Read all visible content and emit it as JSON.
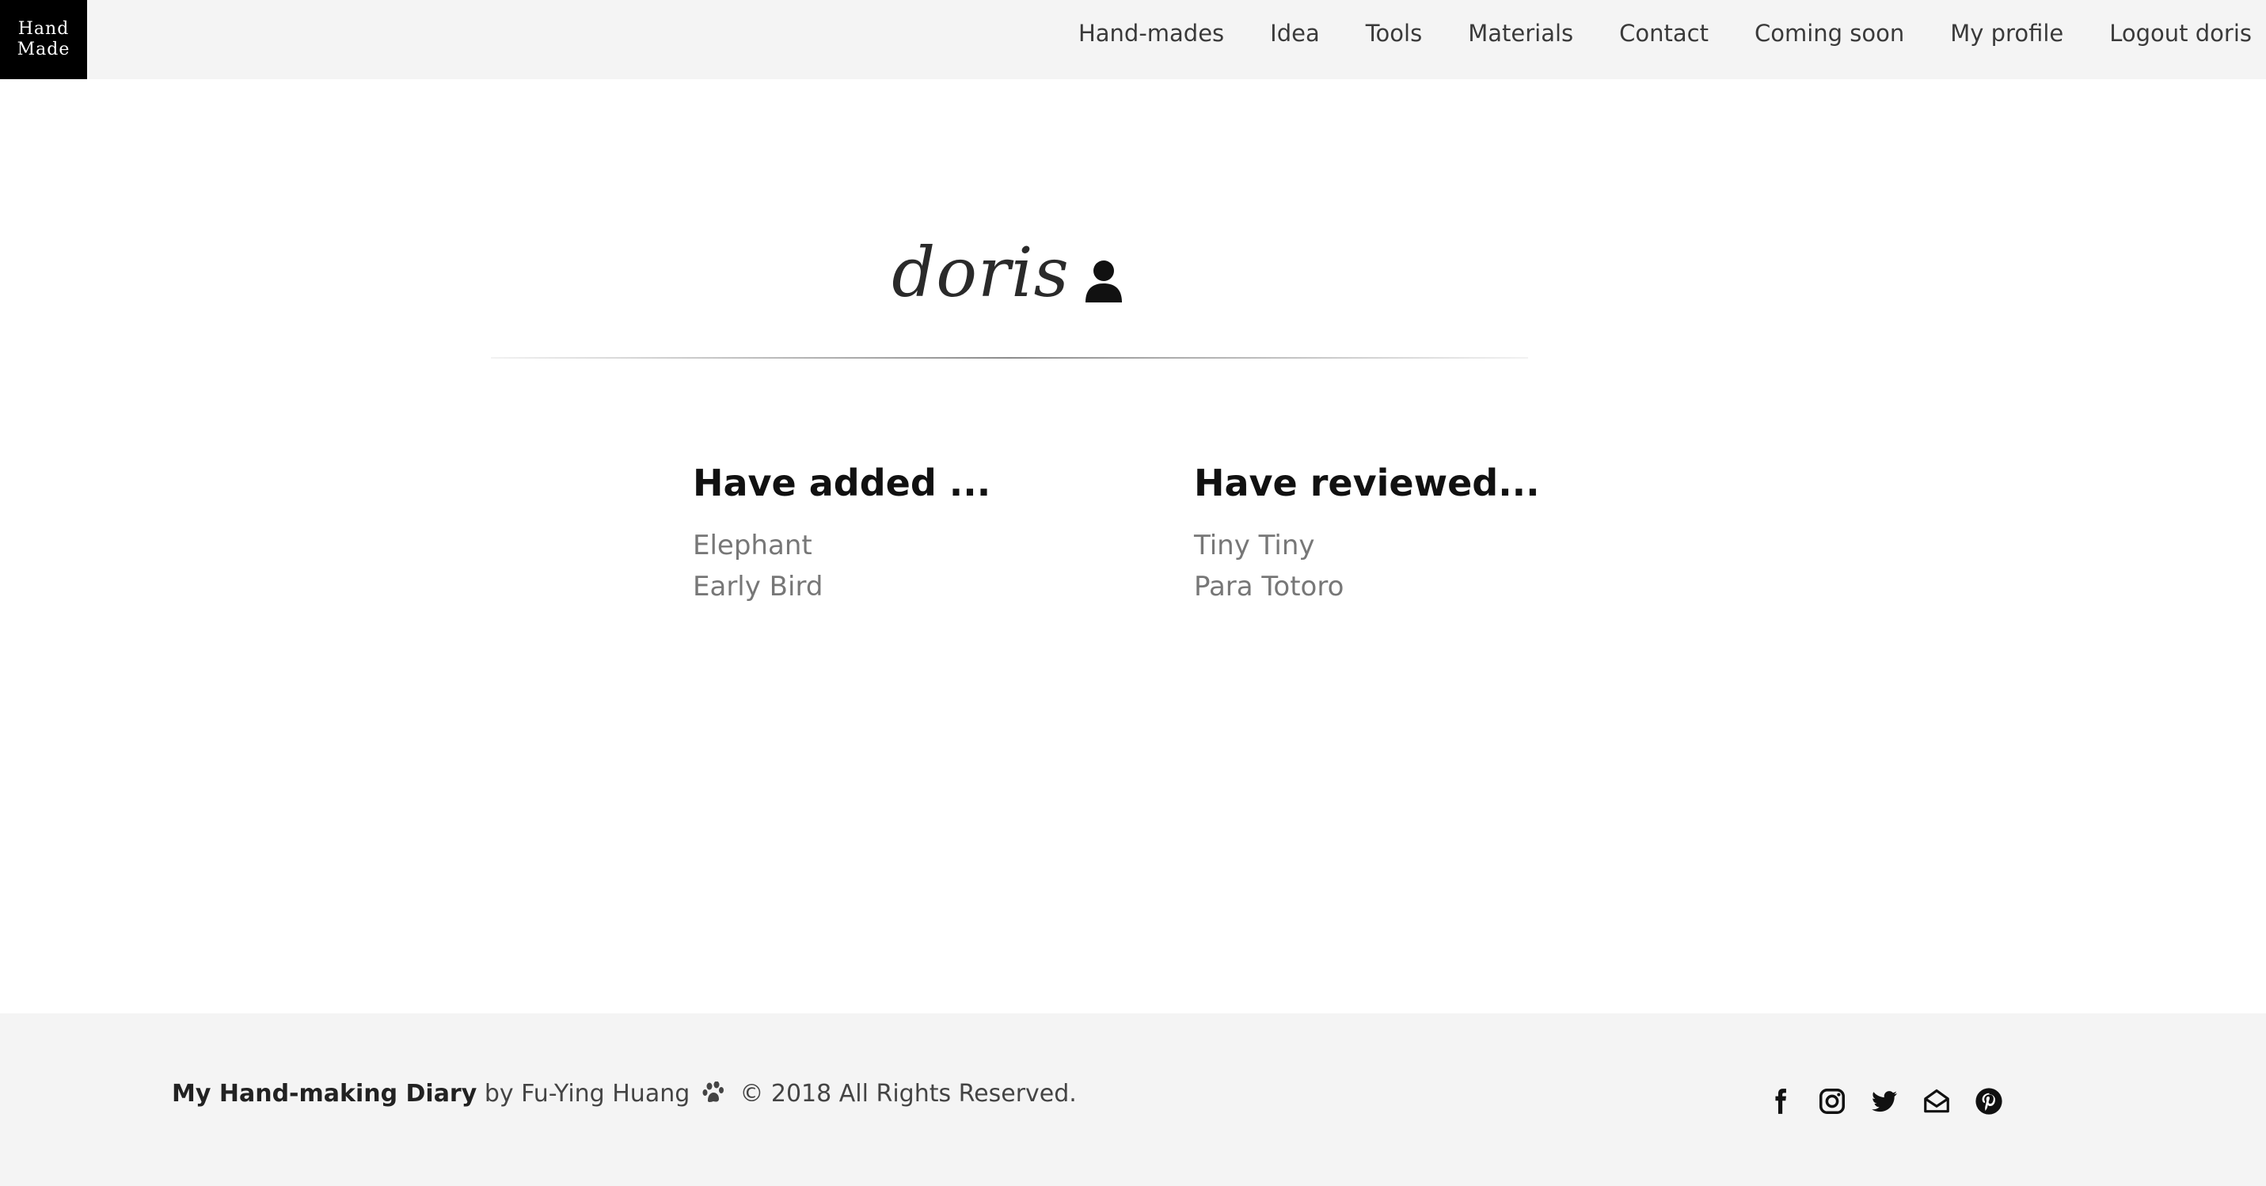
{
  "logo": {
    "line1": "Hand",
    "line2": "Made"
  },
  "nav": {
    "items": [
      {
        "label": "Hand-mades"
      },
      {
        "label": "Idea"
      },
      {
        "label": "Tools"
      },
      {
        "label": "Materials"
      },
      {
        "label": "Contact"
      },
      {
        "label": "Coming soon"
      },
      {
        "label": "My profile"
      },
      {
        "label": "Logout doris"
      }
    ]
  },
  "profile": {
    "username": "doris",
    "icon": "user-icon"
  },
  "added": {
    "heading": "Have added ...",
    "items": [
      "Elephant",
      "Early Bird"
    ]
  },
  "reviewed": {
    "heading": "Have reviewed...",
    "items": [
      "Tiny Tiny",
      "Para Totoro"
    ]
  },
  "footer": {
    "brand": "My Hand-making Diary",
    "byline": " by Fu-Ying Huang ",
    "paw_icon": "paw-icon",
    "copyright": " © 2018 All Rights Reserved.",
    "socials": [
      "facebook-icon",
      "instagram-icon",
      "twitter-icon",
      "envelope-open-icon",
      "pinterest-icon"
    ]
  }
}
